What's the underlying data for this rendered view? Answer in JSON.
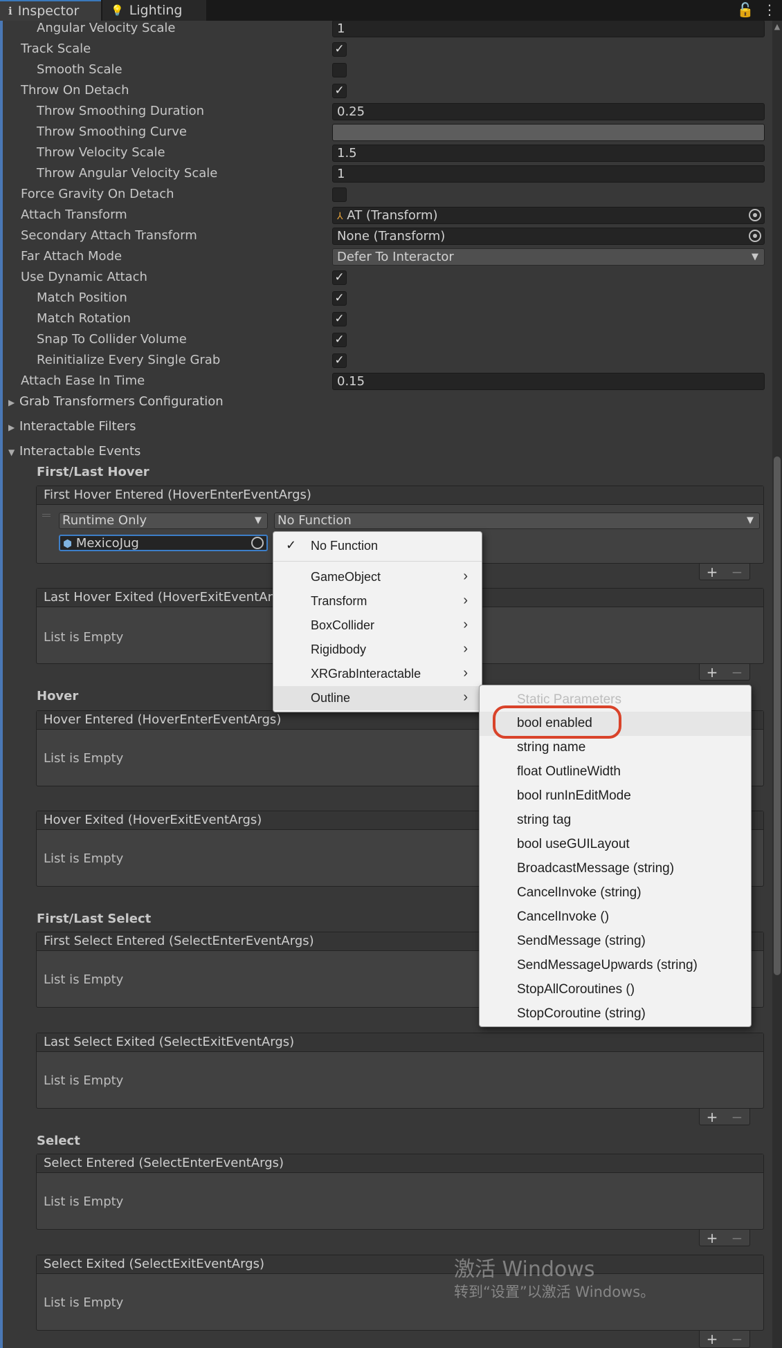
{
  "tabs": [
    {
      "label": "Inspector",
      "icon": "info-icon"
    },
    {
      "label": "Lighting",
      "icon": "bulb-icon"
    }
  ],
  "props": {
    "angular_velocity_scale": {
      "label": "Angular Velocity Scale",
      "value": "1"
    },
    "track_scale": {
      "label": "Track Scale",
      "checked": true
    },
    "smooth_scale": {
      "label": "Smooth Scale",
      "checked": false
    },
    "throw_on_detach": {
      "label": "Throw On Detach",
      "checked": true
    },
    "throw_smoothing_duration": {
      "label": "Throw Smoothing Duration",
      "value": "0.25"
    },
    "throw_smoothing_curve": {
      "label": "Throw Smoothing Curve"
    },
    "throw_velocity_scale": {
      "label": "Throw Velocity Scale",
      "value": "1.5"
    },
    "throw_angular_velocity_scale": {
      "label": "Throw Angular Velocity Scale",
      "value": "1"
    },
    "force_gravity_on_detach": {
      "label": "Force Gravity On Detach",
      "checked": false
    },
    "attach_transform": {
      "label": "Attach Transform",
      "value": "AT (Transform)"
    },
    "secondary_attach_transform": {
      "label": "Secondary Attach Transform",
      "value": "None (Transform)"
    },
    "far_attach_mode": {
      "label": "Far Attach Mode",
      "value": "Defer To Interactor"
    },
    "use_dynamic_attach": {
      "label": "Use Dynamic Attach",
      "checked": true
    },
    "match_position": {
      "label": "Match Position",
      "checked": true
    },
    "match_rotation": {
      "label": "Match Rotation",
      "checked": true
    },
    "snap_to_collider_volume": {
      "label": "Snap To Collider Volume",
      "checked": true
    },
    "reinitialize_every_single_grab": {
      "label": "Reinitialize Every Single Grab",
      "checked": true
    },
    "attach_ease_in_time": {
      "label": "Attach Ease In Time",
      "value": "0.15"
    }
  },
  "foldouts": {
    "grab_transformers": "Grab Transformers Configuration",
    "interactable_filters": "Interactable Filters",
    "interactable_events": "Interactable Events"
  },
  "sections": {
    "first_last_hover": "First/Last Hover",
    "hover": "Hover",
    "first_last_select": "First/Last Select",
    "select": "Select"
  },
  "events": {
    "first_hover_entered": "First Hover Entered (HoverEnterEventArgs)",
    "last_hover_exited": "Last Hover Exited (HoverExitEventArgs)",
    "hover_entered": "Hover Entered (HoverEnterEventArgs)",
    "hover_exited": "Hover Exited (HoverExitEventArgs)",
    "first_select_entered": "First Select Entered (SelectEnterEventArgs)",
    "last_select_exited": "Last Select Exited (SelectExitEventArgs)",
    "select_entered": "Select Entered (SelectEnterEventArgs)",
    "select_exited": "Select Exited (SelectExitEventArgs)",
    "empty_text": "List is Empty",
    "runtime_mode": "Runtime Only",
    "function": "No Function",
    "target_object": "MexicoJug",
    "plus": "+",
    "minus": "−"
  },
  "menu": {
    "items": [
      "No Function",
      "GameObject",
      "Transform",
      "BoxCollider",
      "Rigidbody",
      "XRGrabInteractable",
      "Outline"
    ],
    "selected": "No Function",
    "highlighted": "Outline"
  },
  "submenu": {
    "header": "Static Parameters",
    "items": [
      "bool enabled",
      "string name",
      "float OutlineWidth",
      "bool runInEditMode",
      "string tag",
      "bool useGUILayout",
      "BroadcastMessage (string)",
      "CancelInvoke (string)",
      "CancelInvoke ()",
      "SendMessage (string)",
      "SendMessageUpwards (string)",
      "StopAllCoroutines ()",
      "StopCoroutine (string)"
    ],
    "highlighted": "bool enabled",
    "annotation_color": "#d9432a"
  },
  "watermark": {
    "line1": "激活 Windows",
    "line2": "转到“设置”以激活 Windows。"
  }
}
